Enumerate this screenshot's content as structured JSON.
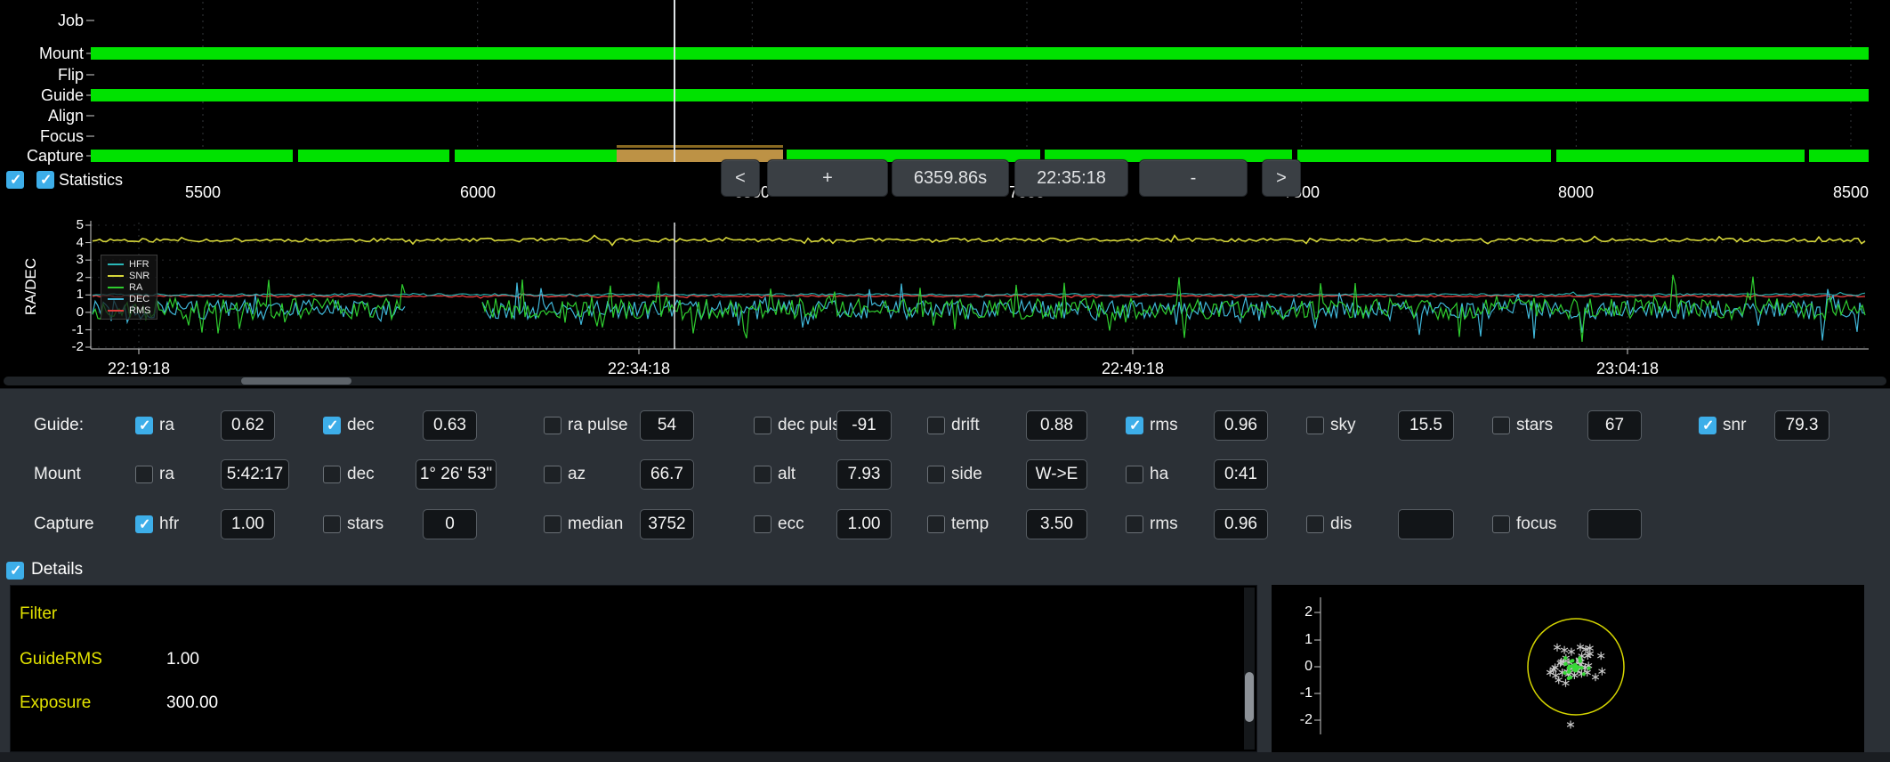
{
  "colors": {
    "accent": "#3daee9",
    "timeline_green": "#00e200",
    "timeline_orange": "#bd9245",
    "detail_yellow": "#e2e200"
  },
  "timeline": {
    "row_labels": [
      "Job",
      "Mount",
      "Flip",
      "Guide",
      "Align",
      "Focus",
      "Capture"
    ],
    "xtick_labels": [
      "5500",
      "6000",
      "6500",
      "7000",
      "7500",
      "8000",
      "8500"
    ],
    "bar_color": "#00e200",
    "capture_alt_color": "#bd9245",
    "mount_bar": [
      102,
      2100
    ],
    "guide_bar": [
      102,
      2100
    ],
    "capture_segments": [
      [
        102,
        329,
        "main"
      ],
      [
        335,
        505,
        "main"
      ],
      [
        511,
        693,
        "main"
      ],
      [
        693,
        880,
        "alt"
      ],
      [
        884,
        1169,
        "main"
      ],
      [
        1174,
        1452,
        "main"
      ],
      [
        1458,
        1743,
        "main"
      ],
      [
        1749,
        2028,
        "main"
      ],
      [
        2033,
        2100,
        "main"
      ]
    ],
    "cursor_x": 758
  },
  "toolbar": {
    "prev_label": "<",
    "zoom_in_label": "+",
    "duration_value": "6359.86s",
    "time_value": "22:35:18",
    "zoom_out_label": "-",
    "next_label": ">"
  },
  "statistics_toggle": {
    "label": "Statistics",
    "left_checked": true,
    "right_checked": true
  },
  "radec_chart": {
    "ylabel": "RA/DEC",
    "ytick_labels": [
      "5",
      "4",
      "3",
      "2",
      "1",
      "0",
      "-1",
      "-2"
    ],
    "xtick_labels": [
      "22:19:18",
      "22:34:18",
      "22:49:18",
      "23:04:18"
    ],
    "legend": [
      {
        "label": "HFR",
        "color": "#2ab8b8"
      },
      {
        "label": "SNR",
        "color": "#d6d63a"
      },
      {
        "label": "RA",
        "color": "#2ecc2e"
      },
      {
        "label": "DEC",
        "color": "#3fb6d8"
      },
      {
        "label": "RMS",
        "color": "#e03a3a"
      }
    ],
    "series": [
      {
        "name": "SNR",
        "color": "#d6d63a",
        "mean": 4.15,
        "amp": 0.1,
        "spike": 0.3,
        "spike_p": 0.05,
        "seed": 11,
        "step": 4,
        "gap": null,
        "width": 1.6
      },
      {
        "name": "RMS",
        "color": "#e03a3a",
        "mean": 0.93,
        "amp": 0.05,
        "spike": 0.12,
        "spike_p": 0.05,
        "seed": 22,
        "step": 4,
        "gap": null,
        "width": 1.4
      },
      {
        "name": "HFR",
        "color": "#2ab8b8",
        "mean": 1.02,
        "amp": 0.06,
        "spike": 0.12,
        "spike_p": 0.04,
        "seed": 33,
        "step": 4,
        "gap": null,
        "width": 1.1
      },
      {
        "name": "DEC",
        "color": "#3fb6d8",
        "mean": 0.15,
        "amp": 0.55,
        "spike": 1.4,
        "spike_p": 0.1,
        "seed": 44,
        "step": 3,
        "gap": [
          455,
          540
        ],
        "width": 1.2
      },
      {
        "name": "RA",
        "color": "#2ecc2e",
        "mean": 0.2,
        "amp": 0.6,
        "spike": 1.6,
        "spike_p": 0.12,
        "seed": 55,
        "step": 3,
        "gap": [
          455,
          540
        ],
        "width": 1.2
      }
    ]
  },
  "stats": {
    "guide": {
      "label": "Guide:",
      "items": [
        {
          "label": "ra",
          "checked": true,
          "value": "0.62"
        },
        {
          "label": "dec",
          "checked": true,
          "value": "0.63"
        },
        {
          "label": "ra pulse",
          "checked": false,
          "value": "54"
        },
        {
          "label": "dec pulse",
          "checked": false,
          "value": "-91"
        },
        {
          "label": "drift",
          "checked": false,
          "value": "0.88"
        },
        {
          "label": "rms",
          "checked": true,
          "value": "0.96"
        },
        {
          "label": "sky",
          "checked": false,
          "value": "15.5"
        },
        {
          "label": "stars",
          "checked": false,
          "value": "67"
        },
        {
          "label": "snr",
          "checked": true,
          "value": "79.3"
        }
      ]
    },
    "mount": {
      "label": "Mount",
      "items": [
        {
          "label": "ra",
          "checked": false,
          "value": "5:42:17"
        },
        {
          "label": "dec",
          "checked": false,
          "value": "1° 26' 53\""
        },
        {
          "label": "az",
          "checked": false,
          "value": "66.7"
        },
        {
          "label": "alt",
          "checked": false,
          "value": "7.93"
        },
        {
          "label": "side",
          "checked": false,
          "value": "W->E"
        },
        {
          "label": "ha",
          "checked": false,
          "value": "0:41"
        }
      ]
    },
    "capture": {
      "label": "Capture",
      "items": [
        {
          "label": "hfr",
          "checked": true,
          "value": "1.00"
        },
        {
          "label": "stars",
          "checked": false,
          "value": "0"
        },
        {
          "label": "median",
          "checked": false,
          "value": "3752"
        },
        {
          "label": "ecc",
          "checked": false,
          "value": "1.00"
        },
        {
          "label": "temp",
          "checked": false,
          "value": "3.50"
        },
        {
          "label": "rms",
          "checked": false,
          "value": "0.96"
        },
        {
          "label": "dis",
          "checked": false,
          "value": ""
        },
        {
          "label": "focus",
          "checked": false,
          "value": ""
        }
      ]
    }
  },
  "details": {
    "label": "Details",
    "checked": true,
    "rows": [
      {
        "name": "Filter",
        "value": ""
      },
      {
        "name": "GuideRMS",
        "value": "1.00"
      },
      {
        "name": "Exposure",
        "value": "300.00"
      }
    ]
  },
  "drift_plot": {
    "ytick_labels": [
      "2",
      "1",
      "0",
      "-1",
      "-2"
    ],
    "circle_color": "#d6d600",
    "star_color": "#c8c8c8",
    "dot_color": "#38d838",
    "stars": 40,
    "dots": 26,
    "seed": 9
  }
}
